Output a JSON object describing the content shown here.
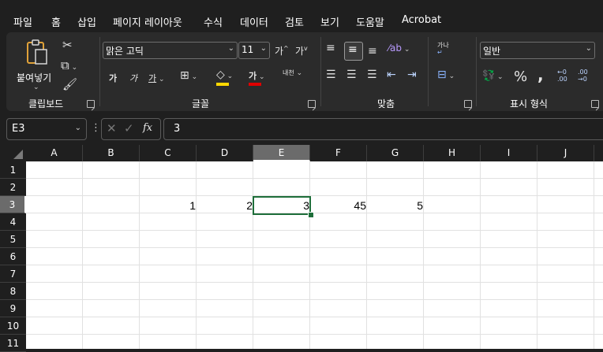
{
  "menu": {
    "tabs": [
      "파일",
      "홈",
      "삽입",
      "페이지 레이아웃",
      "수식",
      "데이터",
      "검토",
      "보기",
      "도움말",
      "Acrobat"
    ],
    "active": "홈"
  },
  "ribbon": {
    "clipboard": {
      "label": "클립보드",
      "paste_label": "붙여넣기"
    },
    "font": {
      "label": "글꼴",
      "font_name": "맑은 고딕",
      "font_size": "11",
      "grow_label": "가",
      "shrink_label": "가",
      "bold_label": "가",
      "italic_label": "가",
      "underline_label": "가",
      "font_color_label": "가",
      "phonetic_label": "내천"
    },
    "alignment": {
      "label": "맞춤",
      "wrap_label": "가나"
    },
    "number": {
      "label": "표시 형식",
      "format": "일반",
      "percent": "%",
      "comma": ","
    }
  },
  "formula_bar": {
    "name_box": "E3",
    "fx_label": "fx",
    "value": "3"
  },
  "grid": {
    "columns": [
      "A",
      "B",
      "C",
      "D",
      "E",
      "F",
      "G",
      "H",
      "I",
      "J"
    ],
    "rows": [
      "1",
      "2",
      "3",
      "4",
      "5",
      "6",
      "7",
      "8",
      "9",
      "10",
      "11"
    ],
    "selected_column": "E",
    "selected_row": "3",
    "row3": {
      "C": "1",
      "D": "2",
      "E": "3",
      "F": "45",
      "G": "5"
    }
  },
  "colors": {
    "background": "#1f1f1f",
    "ribbon": "#2b2b2b",
    "selection": "#1e6e3a",
    "highlight_yellow": "#ffd700",
    "font_red": "#e00000"
  }
}
